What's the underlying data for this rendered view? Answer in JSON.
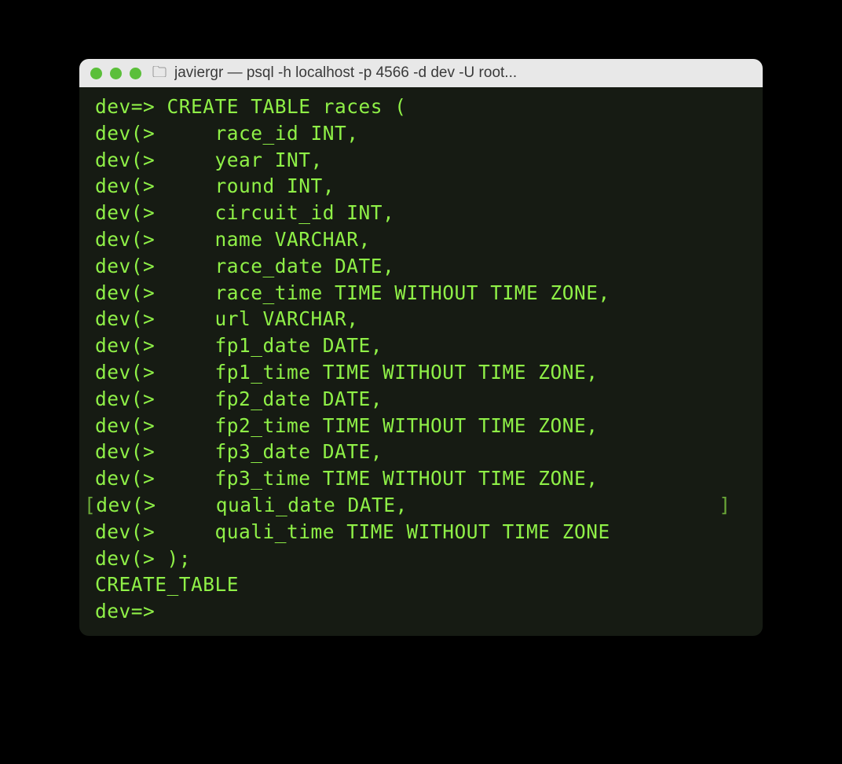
{
  "window": {
    "title": "javiergr — psql -h localhost -p 4566 -d dev -U root..."
  },
  "terminal": {
    "prompt_main": "dev=>",
    "prompt_cont": "dev(>",
    "lines": [
      {
        "prompt": "dev=> ",
        "text": "CREATE TABLE races ("
      },
      {
        "prompt": "dev(> ",
        "text": "    race_id INT,"
      },
      {
        "prompt": "dev(> ",
        "text": "    year INT,"
      },
      {
        "prompt": "dev(> ",
        "text": "    round INT,"
      },
      {
        "prompt": "dev(> ",
        "text": "    circuit_id INT,"
      },
      {
        "prompt": "dev(> ",
        "text": "    name VARCHAR,"
      },
      {
        "prompt": "dev(> ",
        "text": "    race_date DATE,"
      },
      {
        "prompt": "dev(> ",
        "text": "    race_time TIME WITHOUT TIME ZONE,"
      },
      {
        "prompt": "dev(> ",
        "text": "    url VARCHAR,"
      },
      {
        "prompt": "dev(> ",
        "text": "    fp1_date DATE,"
      },
      {
        "prompt": "dev(> ",
        "text": "    fp1_time TIME WITHOUT TIME ZONE,"
      },
      {
        "prompt": "dev(> ",
        "text": "    fp2_date DATE,"
      },
      {
        "prompt": "dev(> ",
        "text": "    fp2_time TIME WITHOUT TIME ZONE,"
      },
      {
        "prompt": "dev(> ",
        "text": "    fp3_date DATE,"
      },
      {
        "prompt": "dev(> ",
        "text": "    fp3_time TIME WITHOUT TIME ZONE,"
      },
      {
        "prompt": "dev(> ",
        "text": "    quali_date DATE,",
        "bracketed": true
      },
      {
        "prompt": "dev(> ",
        "text": "    quali_time TIME WITHOUT TIME ZONE"
      },
      {
        "prompt": "dev(> ",
        "text": ");"
      }
    ],
    "result": "CREATE_TABLE",
    "final_prompt": "dev=> "
  }
}
